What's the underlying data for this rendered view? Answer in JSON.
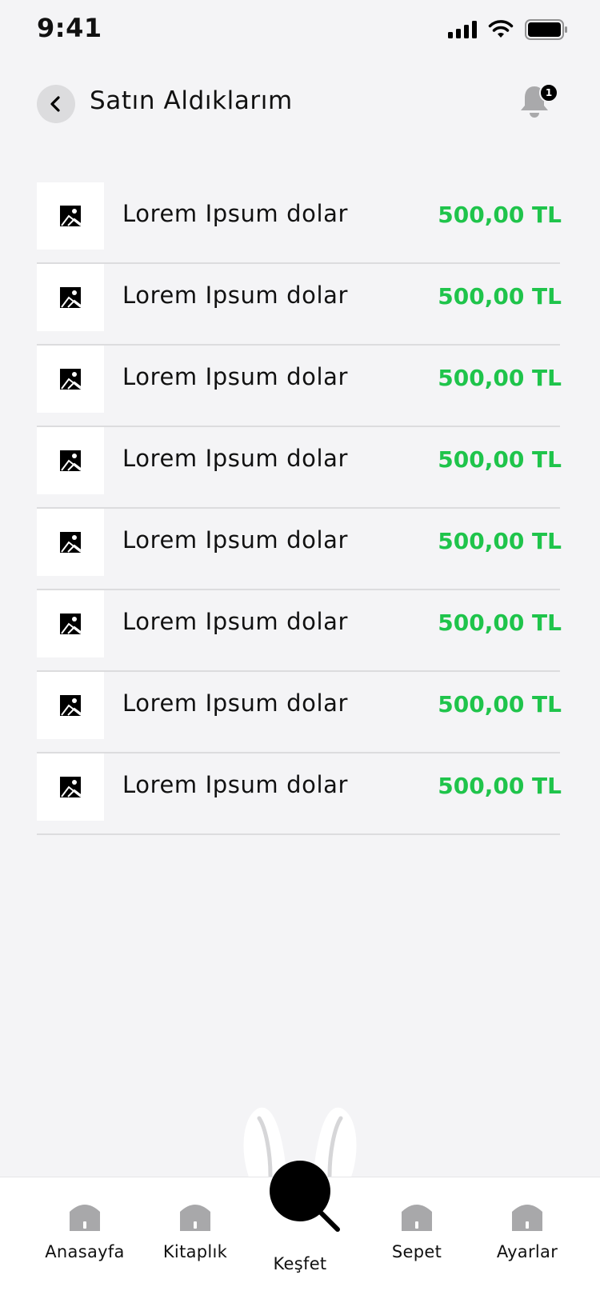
{
  "status_bar": {
    "time": "9:41"
  },
  "header": {
    "title": "Satın Aldıklarım",
    "notification_count": "1"
  },
  "colors": {
    "price": "#1fc44b",
    "background": "#f4f4f6"
  },
  "purchases": [
    {
      "title": "Lorem Ipsum dolar",
      "price": "500,00 TL",
      "thumbnail_icon": "image-icon"
    },
    {
      "title": "Lorem Ipsum dolar",
      "price": "500,00 TL",
      "thumbnail_icon": "image-icon"
    },
    {
      "title": "Lorem Ipsum dolar",
      "price": "500,00 TL",
      "thumbnail_icon": "image-icon"
    },
    {
      "title": "Lorem Ipsum dolar",
      "price": "500,00 TL",
      "thumbnail_icon": "image-icon"
    },
    {
      "title": "Lorem Ipsum dolar",
      "price": "500,00 TL",
      "thumbnail_icon": "image-icon"
    },
    {
      "title": "Lorem Ipsum dolar",
      "price": "500,00 TL",
      "thumbnail_icon": "image-icon"
    },
    {
      "title": "Lorem Ipsum dolar",
      "price": "500,00 TL",
      "thumbnail_icon": "image-icon"
    },
    {
      "title": "Lorem Ipsum dolar",
      "price": "500,00 TL",
      "thumbnail_icon": "image-icon"
    }
  ],
  "tabbar": {
    "items": [
      {
        "label": "Anasayfa",
        "icon": "home-icon"
      },
      {
        "label": "Kitaplık",
        "icon": "home-icon"
      },
      {
        "label": "Keşfet",
        "icon": "search-icon"
      },
      {
        "label": "Sepet",
        "icon": "home-icon"
      },
      {
        "label": "Ayarlar",
        "icon": "home-icon"
      }
    ]
  }
}
